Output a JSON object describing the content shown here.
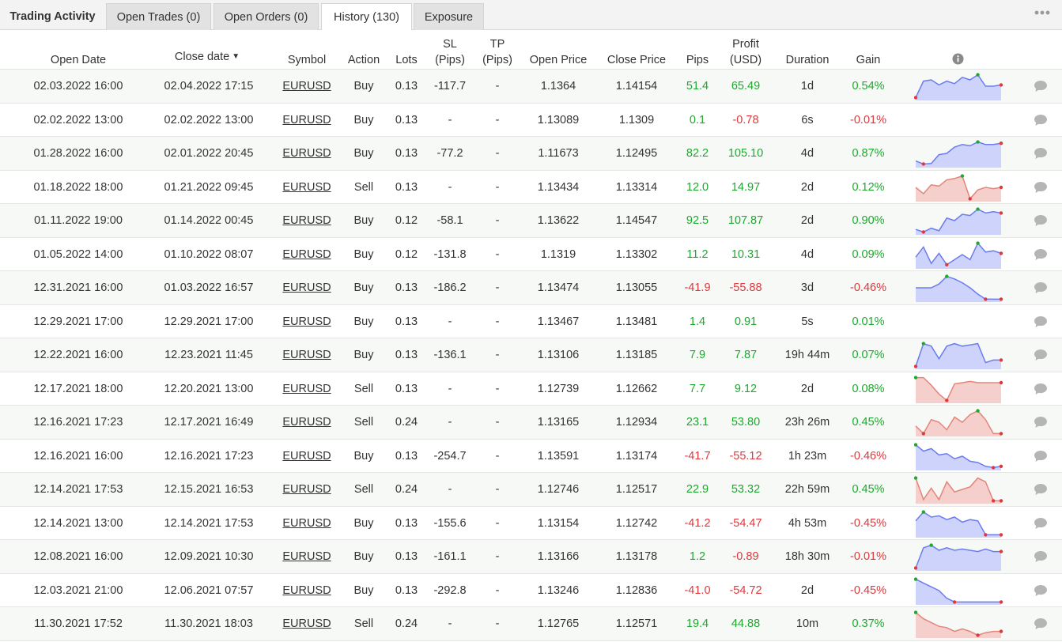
{
  "tabs": [
    {
      "label": "Trading Activity"
    },
    {
      "label": "Open Trades (0)"
    },
    {
      "label": "Open Orders (0)"
    },
    {
      "label": "History (130)"
    },
    {
      "label": "Exposure"
    }
  ],
  "columns": {
    "open_date": "Open Date",
    "close_date": "Close date",
    "symbol": "Symbol",
    "action": "Action",
    "lots": "Lots",
    "sl": "SL",
    "sl_unit": "(Pips)",
    "tp": "TP",
    "tp_unit": "(Pips)",
    "open_price": "Open Price",
    "close_price": "Close Price",
    "pips": "Pips",
    "profit": "Profit",
    "profit_unit": "(USD)",
    "duration": "Duration",
    "gain": "Gain"
  },
  "colors": {
    "positive": "#1ea82f",
    "negative": "#e0383c",
    "spark_blue": "#6b7cf0",
    "spark_red": "#e5857a"
  },
  "rows": [
    {
      "open_date": "02.03.2022 16:00",
      "close_date": "02.04.2022 17:15",
      "symbol": "EURUSD",
      "action": "Buy",
      "lots": "0.13",
      "sl": "-117.7",
      "tp": "-",
      "open_price": "1.1364",
      "close_price": "1.14154",
      "pips": "51.4",
      "profit": "65.49",
      "duration": "1d",
      "gain": "0.54%",
      "trend": "pos",
      "spark": [
        0.05,
        0.7,
        0.75,
        0.55,
        0.7,
        0.6,
        0.85,
        0.75,
        0.95,
        0.5,
        0.5,
        0.55
      ]
    },
    {
      "open_date": "02.02.2022 13:00",
      "close_date": "02.02.2022 13:00",
      "symbol": "EURUSD",
      "action": "Buy",
      "lots": "0.13",
      "sl": "-",
      "tp": "-",
      "open_price": "1.13089",
      "close_price": "1.1309",
      "pips": "0.1",
      "profit": "-0.78",
      "duration": "6s",
      "gain": "-0.01%",
      "trend": "neg",
      "spark": []
    },
    {
      "open_date": "01.28.2022 16:00",
      "close_date": "02.01.2022 20:45",
      "symbol": "EURUSD",
      "action": "Buy",
      "lots": "0.13",
      "sl": "-77.2",
      "tp": "-",
      "open_price": "1.11673",
      "close_price": "1.12495",
      "pips": "82.2",
      "profit": "105.10",
      "duration": "4d",
      "gain": "0.87%",
      "trend": "pos",
      "spark": [
        0.2,
        0.08,
        0.1,
        0.45,
        0.5,
        0.75,
        0.85,
        0.8,
        0.95,
        0.85,
        0.85,
        0.9
      ]
    },
    {
      "open_date": "01.18.2022 18:00",
      "close_date": "01.21.2022 09:45",
      "symbol": "EURUSD",
      "action": "Sell",
      "lots": "0.13",
      "sl": "-",
      "tp": "-",
      "open_price": "1.13434",
      "close_price": "1.13314",
      "pips": "12.0",
      "profit": "14.97",
      "duration": "2d",
      "gain": "0.12%",
      "trend": "pos",
      "spark": [
        0.5,
        0.25,
        0.6,
        0.55,
        0.8,
        0.85,
        0.95,
        0.05,
        0.4,
        0.5,
        0.45,
        0.5
      ]
    },
    {
      "open_date": "01.11.2022 19:00",
      "close_date": "01.14.2022 00:45",
      "symbol": "EURUSD",
      "action": "Buy",
      "lots": "0.12",
      "sl": "-58.1",
      "tp": "-",
      "open_price": "1.13622",
      "close_price": "1.14547",
      "pips": "92.5",
      "profit": "107.87",
      "duration": "2d",
      "gain": "0.90%",
      "trend": "pos",
      "spark": [
        0.15,
        0.05,
        0.2,
        0.1,
        0.6,
        0.5,
        0.75,
        0.7,
        0.95,
        0.8,
        0.85,
        0.8
      ]
    },
    {
      "open_date": "01.05.2022 14:00",
      "close_date": "01.10.2022 08:07",
      "symbol": "EURUSD",
      "action": "Buy",
      "lots": "0.12",
      "sl": "-131.8",
      "tp": "-",
      "open_price": "1.1319",
      "close_price": "1.13302",
      "pips": "11.2",
      "profit": "10.31",
      "duration": "4d",
      "gain": "0.09%",
      "trend": "pos",
      "spark": [
        0.4,
        0.8,
        0.15,
        0.55,
        0.1,
        0.3,
        0.5,
        0.3,
        0.95,
        0.6,
        0.65,
        0.55
      ]
    },
    {
      "open_date": "12.31.2021 16:00",
      "close_date": "01.03.2022 16:57",
      "symbol": "EURUSD",
      "action": "Buy",
      "lots": "0.13",
      "sl": "-186.2",
      "tp": "-",
      "open_price": "1.13474",
      "close_price": "1.13055",
      "pips": "-41.9",
      "profit": "-55.88",
      "duration": "3d",
      "gain": "-0.46%",
      "trend": "neg",
      "spark": [
        0.5,
        0.5,
        0.5,
        0.65,
        0.95,
        0.85,
        0.7,
        0.5,
        0.25,
        0.05,
        0.05,
        0.05
      ]
    },
    {
      "open_date": "12.29.2021 17:00",
      "close_date": "12.29.2021 17:00",
      "symbol": "EURUSD",
      "action": "Buy",
      "lots": "0.13",
      "sl": "-",
      "tp": "-",
      "open_price": "1.13467",
      "close_price": "1.13481",
      "pips": "1.4",
      "profit": "0.91",
      "duration": "5s",
      "gain": "0.01%",
      "trend": "pos",
      "spark": []
    },
    {
      "open_date": "12.22.2021 16:00",
      "close_date": "12.23.2021 11:45",
      "symbol": "EURUSD",
      "action": "Buy",
      "lots": "0.13",
      "sl": "-136.1",
      "tp": "-",
      "open_price": "1.13106",
      "close_price": "1.13185",
      "pips": "7.9",
      "profit": "7.87",
      "duration": "19h 44m",
      "gain": "0.07%",
      "trend": "pos",
      "spark": [
        0.05,
        0.95,
        0.85,
        0.35,
        0.85,
        0.95,
        0.85,
        0.9,
        0.95,
        0.2,
        0.3,
        0.3
      ]
    },
    {
      "open_date": "12.17.2021 18:00",
      "close_date": "12.20.2021 13:00",
      "symbol": "EURUSD",
      "action": "Sell",
      "lots": "0.13",
      "sl": "-",
      "tp": "-",
      "open_price": "1.12739",
      "close_price": "1.12662",
      "pips": "7.7",
      "profit": "9.12",
      "duration": "2d",
      "gain": "0.08%",
      "trend": "pos",
      "spark": [
        0.95,
        0.95,
        0.65,
        0.3,
        0.05,
        0.7,
        0.75,
        0.8,
        0.75,
        0.75,
        0.75,
        0.75
      ]
    },
    {
      "open_date": "12.16.2021 17:23",
      "close_date": "12.17.2021 16:49",
      "symbol": "EURUSD",
      "action": "Sell",
      "lots": "0.24",
      "sl": "-",
      "tp": "-",
      "open_price": "1.13165",
      "close_price": "1.12934",
      "pips": "23.1",
      "profit": "53.80",
      "duration": "23h 26m",
      "gain": "0.45%",
      "trend": "pos",
      "spark": [
        0.35,
        0.05,
        0.6,
        0.5,
        0.2,
        0.7,
        0.5,
        0.8,
        0.95,
        0.6,
        0.05,
        0.05
      ]
    },
    {
      "open_date": "12.16.2021 16:00",
      "close_date": "12.16.2021 17:23",
      "symbol": "EURUSD",
      "action": "Buy",
      "lots": "0.13",
      "sl": "-254.7",
      "tp": "-",
      "open_price": "1.13591",
      "close_price": "1.13174",
      "pips": "-41.7",
      "profit": "-55.12",
      "duration": "1h 23m",
      "gain": "-0.46%",
      "trend": "neg",
      "spark": [
        0.95,
        0.7,
        0.8,
        0.55,
        0.6,
        0.4,
        0.5,
        0.3,
        0.25,
        0.1,
        0.05,
        0.1
      ]
    },
    {
      "open_date": "12.14.2021 17:53",
      "close_date": "12.15.2021 16:53",
      "symbol": "EURUSD",
      "action": "Sell",
      "lots": "0.24",
      "sl": "-",
      "tp": "-",
      "open_price": "1.12746",
      "close_price": "1.12517",
      "pips": "22.9",
      "profit": "53.32",
      "duration": "22h 59m",
      "gain": "0.45%",
      "trend": "pos",
      "spark": [
        0.95,
        0.1,
        0.55,
        0.1,
        0.8,
        0.4,
        0.5,
        0.6,
        0.95,
        0.8,
        0.05,
        0.05
      ]
    },
    {
      "open_date": "12.14.2021 13:00",
      "close_date": "12.14.2021 17:53",
      "symbol": "EURUSD",
      "action": "Buy",
      "lots": "0.13",
      "sl": "-155.6",
      "tp": "-",
      "open_price": "1.13154",
      "close_price": "1.12742",
      "pips": "-41.2",
      "profit": "-54.47",
      "duration": "4h 53m",
      "gain": "-0.45%",
      "trend": "neg",
      "spark": [
        0.6,
        0.95,
        0.75,
        0.8,
        0.65,
        0.75,
        0.55,
        0.65,
        0.6,
        0.05,
        0.05,
        0.05
      ]
    },
    {
      "open_date": "12.08.2021 16:00",
      "close_date": "12.09.2021 10:30",
      "symbol": "EURUSD",
      "action": "Buy",
      "lots": "0.13",
      "sl": "-161.1",
      "tp": "-",
      "open_price": "1.13166",
      "close_price": "1.13178",
      "pips": "1.2",
      "profit": "-0.89",
      "duration": "18h 30m",
      "gain": "-0.01%",
      "trend": "neg",
      "spark": [
        0.05,
        0.85,
        0.95,
        0.75,
        0.85,
        0.75,
        0.8,
        0.75,
        0.7,
        0.8,
        0.7,
        0.7
      ]
    },
    {
      "open_date": "12.03.2021 21:00",
      "close_date": "12.06.2021 07:57",
      "symbol": "EURUSD",
      "action": "Buy",
      "lots": "0.13",
      "sl": "-292.8",
      "tp": "-",
      "open_price": "1.13246",
      "close_price": "1.12836",
      "pips": "-41.0",
      "profit": "-54.72",
      "duration": "2d",
      "gain": "-0.45%",
      "trend": "neg",
      "spark": [
        0.95,
        0.8,
        0.65,
        0.5,
        0.2,
        0.05,
        0.05,
        0.05,
        0.05,
        0.05,
        0.05,
        0.05
      ]
    },
    {
      "open_date": "11.30.2021 17:52",
      "close_date": "11.30.2021 18:03",
      "symbol": "EURUSD",
      "action": "Sell",
      "lots": "0.24",
      "sl": "-",
      "tp": "-",
      "open_price": "1.12765",
      "close_price": "1.12571",
      "pips": "19.4",
      "profit": "44.88",
      "duration": "10m",
      "gain": "0.37%",
      "trend": "pos",
      "spark": [
        0.95,
        0.7,
        0.55,
        0.4,
        0.35,
        0.2,
        0.3,
        0.2,
        0.05,
        0.15,
        0.2,
        0.2
      ]
    }
  ]
}
